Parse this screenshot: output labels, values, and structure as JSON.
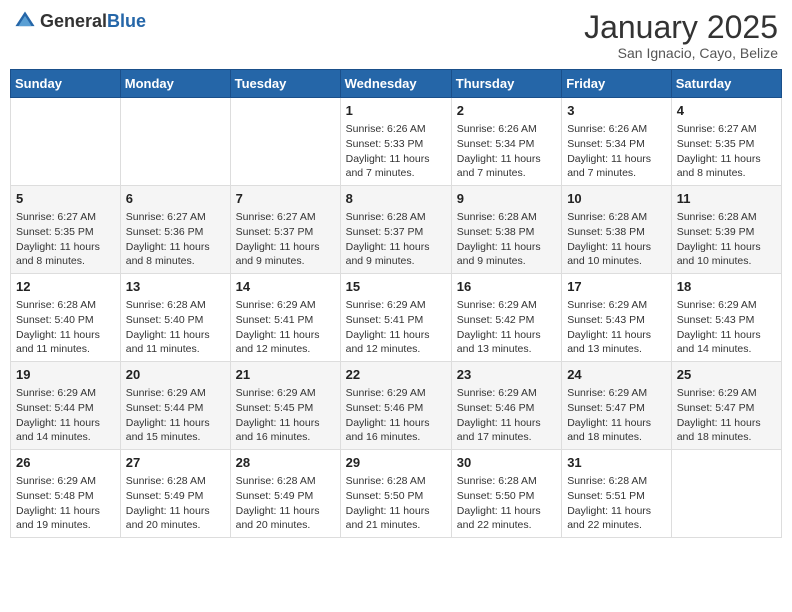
{
  "header": {
    "logo_general": "General",
    "logo_blue": "Blue",
    "month_title": "January 2025",
    "location": "San Ignacio, Cayo, Belize"
  },
  "days_of_week": [
    "Sunday",
    "Monday",
    "Tuesday",
    "Wednesday",
    "Thursday",
    "Friday",
    "Saturday"
  ],
  "weeks": [
    [
      {
        "day": "",
        "sunrise": "",
        "sunset": "",
        "daylight": ""
      },
      {
        "day": "",
        "sunrise": "",
        "sunset": "",
        "daylight": ""
      },
      {
        "day": "",
        "sunrise": "",
        "sunset": "",
        "daylight": ""
      },
      {
        "day": "1",
        "sunrise": "Sunrise: 6:26 AM",
        "sunset": "Sunset: 5:33 PM",
        "daylight": "Daylight: 11 hours and 7 minutes."
      },
      {
        "day": "2",
        "sunrise": "Sunrise: 6:26 AM",
        "sunset": "Sunset: 5:34 PM",
        "daylight": "Daylight: 11 hours and 7 minutes."
      },
      {
        "day": "3",
        "sunrise": "Sunrise: 6:26 AM",
        "sunset": "Sunset: 5:34 PM",
        "daylight": "Daylight: 11 hours and 7 minutes."
      },
      {
        "day": "4",
        "sunrise": "Sunrise: 6:27 AM",
        "sunset": "Sunset: 5:35 PM",
        "daylight": "Daylight: 11 hours and 8 minutes."
      }
    ],
    [
      {
        "day": "5",
        "sunrise": "Sunrise: 6:27 AM",
        "sunset": "Sunset: 5:35 PM",
        "daylight": "Daylight: 11 hours and 8 minutes."
      },
      {
        "day": "6",
        "sunrise": "Sunrise: 6:27 AM",
        "sunset": "Sunset: 5:36 PM",
        "daylight": "Daylight: 11 hours and 8 minutes."
      },
      {
        "day": "7",
        "sunrise": "Sunrise: 6:27 AM",
        "sunset": "Sunset: 5:37 PM",
        "daylight": "Daylight: 11 hours and 9 minutes."
      },
      {
        "day": "8",
        "sunrise": "Sunrise: 6:28 AM",
        "sunset": "Sunset: 5:37 PM",
        "daylight": "Daylight: 11 hours and 9 minutes."
      },
      {
        "day": "9",
        "sunrise": "Sunrise: 6:28 AM",
        "sunset": "Sunset: 5:38 PM",
        "daylight": "Daylight: 11 hours and 9 minutes."
      },
      {
        "day": "10",
        "sunrise": "Sunrise: 6:28 AM",
        "sunset": "Sunset: 5:38 PM",
        "daylight": "Daylight: 11 hours and 10 minutes."
      },
      {
        "day": "11",
        "sunrise": "Sunrise: 6:28 AM",
        "sunset": "Sunset: 5:39 PM",
        "daylight": "Daylight: 11 hours and 10 minutes."
      }
    ],
    [
      {
        "day": "12",
        "sunrise": "Sunrise: 6:28 AM",
        "sunset": "Sunset: 5:40 PM",
        "daylight": "Daylight: 11 hours and 11 minutes."
      },
      {
        "day": "13",
        "sunrise": "Sunrise: 6:28 AM",
        "sunset": "Sunset: 5:40 PM",
        "daylight": "Daylight: 11 hours and 11 minutes."
      },
      {
        "day": "14",
        "sunrise": "Sunrise: 6:29 AM",
        "sunset": "Sunset: 5:41 PM",
        "daylight": "Daylight: 11 hours and 12 minutes."
      },
      {
        "day": "15",
        "sunrise": "Sunrise: 6:29 AM",
        "sunset": "Sunset: 5:41 PM",
        "daylight": "Daylight: 11 hours and 12 minutes."
      },
      {
        "day": "16",
        "sunrise": "Sunrise: 6:29 AM",
        "sunset": "Sunset: 5:42 PM",
        "daylight": "Daylight: 11 hours and 13 minutes."
      },
      {
        "day": "17",
        "sunrise": "Sunrise: 6:29 AM",
        "sunset": "Sunset: 5:43 PM",
        "daylight": "Daylight: 11 hours and 13 minutes."
      },
      {
        "day": "18",
        "sunrise": "Sunrise: 6:29 AM",
        "sunset": "Sunset: 5:43 PM",
        "daylight": "Daylight: 11 hours and 14 minutes."
      }
    ],
    [
      {
        "day": "19",
        "sunrise": "Sunrise: 6:29 AM",
        "sunset": "Sunset: 5:44 PM",
        "daylight": "Daylight: 11 hours and 14 minutes."
      },
      {
        "day": "20",
        "sunrise": "Sunrise: 6:29 AM",
        "sunset": "Sunset: 5:44 PM",
        "daylight": "Daylight: 11 hours and 15 minutes."
      },
      {
        "day": "21",
        "sunrise": "Sunrise: 6:29 AM",
        "sunset": "Sunset: 5:45 PM",
        "daylight": "Daylight: 11 hours and 16 minutes."
      },
      {
        "day": "22",
        "sunrise": "Sunrise: 6:29 AM",
        "sunset": "Sunset: 5:46 PM",
        "daylight": "Daylight: 11 hours and 16 minutes."
      },
      {
        "day": "23",
        "sunrise": "Sunrise: 6:29 AM",
        "sunset": "Sunset: 5:46 PM",
        "daylight": "Daylight: 11 hours and 17 minutes."
      },
      {
        "day": "24",
        "sunrise": "Sunrise: 6:29 AM",
        "sunset": "Sunset: 5:47 PM",
        "daylight": "Daylight: 11 hours and 18 minutes."
      },
      {
        "day": "25",
        "sunrise": "Sunrise: 6:29 AM",
        "sunset": "Sunset: 5:47 PM",
        "daylight": "Daylight: 11 hours and 18 minutes."
      }
    ],
    [
      {
        "day": "26",
        "sunrise": "Sunrise: 6:29 AM",
        "sunset": "Sunset: 5:48 PM",
        "daylight": "Daylight: 11 hours and 19 minutes."
      },
      {
        "day": "27",
        "sunrise": "Sunrise: 6:28 AM",
        "sunset": "Sunset: 5:49 PM",
        "daylight": "Daylight: 11 hours and 20 minutes."
      },
      {
        "day": "28",
        "sunrise": "Sunrise: 6:28 AM",
        "sunset": "Sunset: 5:49 PM",
        "daylight": "Daylight: 11 hours and 20 minutes."
      },
      {
        "day": "29",
        "sunrise": "Sunrise: 6:28 AM",
        "sunset": "Sunset: 5:50 PM",
        "daylight": "Daylight: 11 hours and 21 minutes."
      },
      {
        "day": "30",
        "sunrise": "Sunrise: 6:28 AM",
        "sunset": "Sunset: 5:50 PM",
        "daylight": "Daylight: 11 hours and 22 minutes."
      },
      {
        "day": "31",
        "sunrise": "Sunrise: 6:28 AM",
        "sunset": "Sunset: 5:51 PM",
        "daylight": "Daylight: 11 hours and 22 minutes."
      },
      {
        "day": "",
        "sunrise": "",
        "sunset": "",
        "daylight": ""
      }
    ]
  ]
}
